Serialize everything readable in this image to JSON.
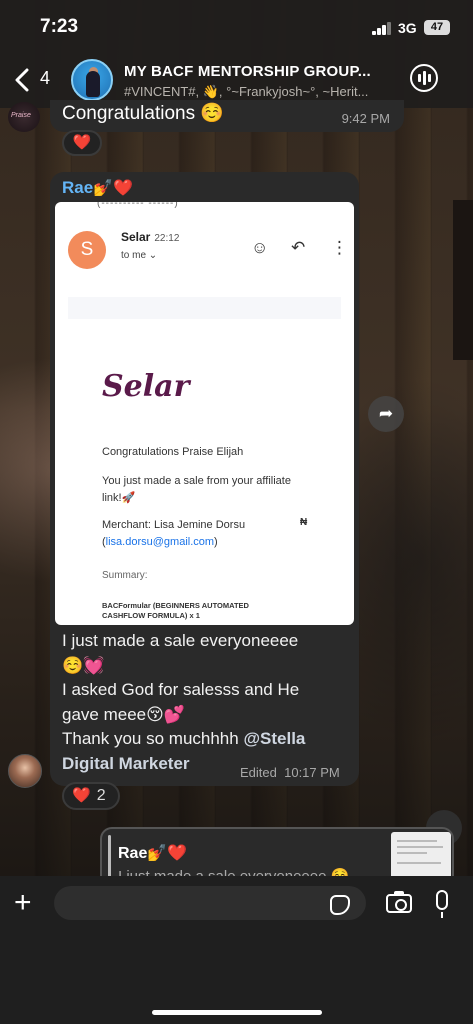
{
  "status_bar": {
    "time": "7:23",
    "network": "3G",
    "battery": "47"
  },
  "header": {
    "back_count": "4",
    "group_title": "MY BACF MENTORSHIP GROUP...",
    "group_members": "#VINCENT#, 👋, °~Frankyjosh~°, ~Herit...",
    "icons": {
      "back": "chevron-left-icon",
      "call": "group-call-icon"
    }
  },
  "messages": {
    "previous": {
      "text": "Congratulations ☺️",
      "time": "9:42 PM",
      "reaction": "❤️"
    },
    "main": {
      "sender_name": "Rae",
      "sender_emoji": "💅❤️",
      "image": {
        "from": "Selar",
        "time": "22:12",
        "to": "to me",
        "logo": "Selar",
        "greeting": "Congratulations Praise Elijah",
        "body_line1": "You just made a sale from your affiliate",
        "body_line2": "link!🚀",
        "merchant": "Merchant: Lisa Jemine Dorsu",
        "merchant_email": "lisa.dorsu@gmail.com",
        "summary": "Summary:",
        "product_line1": "BACFormular (BEGINNERS AUTOMATED",
        "product_line2": "CASHFLOW FORMULA) x 1",
        "currency": "₦"
      },
      "caption": {
        "line1": "I just made a sale everyoneeee",
        "line2": "☺️💓",
        "line3": "I asked God for salesss and He",
        "line4": "gave meee😚💕",
        "line5_prefix": "Thank you so muchhhh ",
        "mention": "@Stella",
        "line6": "Digital Marketer"
      },
      "edited": "Edited",
      "time": "10:17 PM",
      "reaction": "❤️",
      "reaction_count": "2"
    },
    "reply_preview": {
      "sender_name": "Rae",
      "sender_emoji": "💅❤️",
      "text": "I just made a sale everyoneeee ☺️"
    }
  },
  "input": {
    "placeholder": ""
  }
}
